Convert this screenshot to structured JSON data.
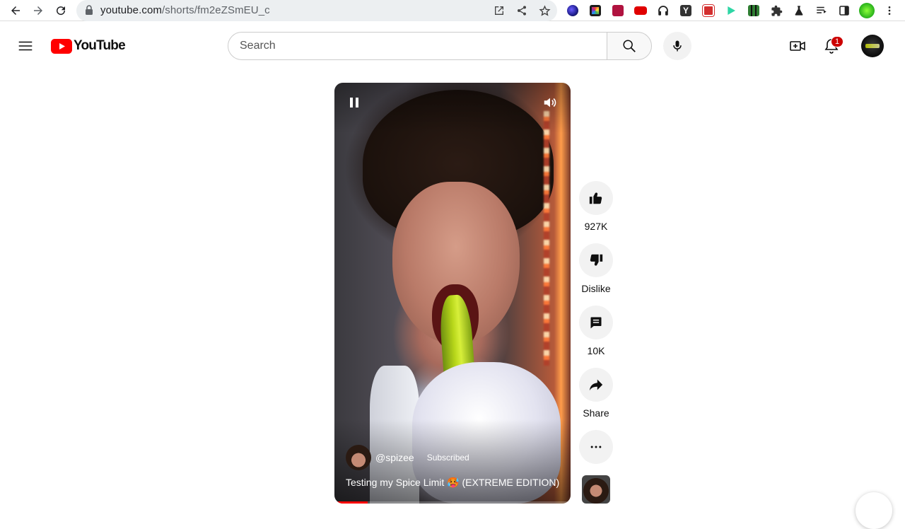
{
  "browser": {
    "url_host": "youtube.com",
    "url_path": "/shorts/fm2eZSmEU_c"
  },
  "header": {
    "logo_text": "YouTube",
    "search_placeholder": "Search",
    "notification_count": "1"
  },
  "short": {
    "channel_handle": "@spizee",
    "subscribe_state": "Subscribed",
    "title": "Testing my Spice Limit 🥵 (EXTREME EDITION)",
    "progress": 0.14
  },
  "actions": {
    "like_count": "927K",
    "dislike_label": "Dislike",
    "comment_count": "10K",
    "share_label": "Share"
  },
  "colors": {
    "brand_red": "#ff0000",
    "badge_red": "#cc0000"
  },
  "extensions": [
    {
      "icon": "globe-ext-icon",
      "color": "#3b3bd8"
    },
    {
      "icon": "camera-ext-icon",
      "color": "#1c1c1c"
    },
    {
      "icon": "music-ext-icon",
      "color": "#c2185b"
    },
    {
      "icon": "youtube-ext-icon",
      "color": "#e00000"
    },
    {
      "icon": "headphones-ext-icon",
      "color": "#222222"
    },
    {
      "icon": "y-ext-icon",
      "color": "#333333"
    },
    {
      "icon": "pdf-ext-icon",
      "color": "#d32f2f"
    },
    {
      "icon": "play-ext-icon",
      "color": "#2ed6a5"
    },
    {
      "icon": "grid-ext-icon",
      "color": "#2e7d32"
    },
    {
      "icon": "puzzle-icon",
      "color": "#333333"
    },
    {
      "icon": "flask-icon",
      "color": "#222222"
    },
    {
      "icon": "reading-list-icon",
      "color": "#222222"
    },
    {
      "icon": "side-panel-icon",
      "color": "#222222"
    },
    {
      "icon": "profile-icon",
      "color": "#3fcf2f"
    },
    {
      "icon": "more-vert-icon",
      "color": "#222222"
    }
  ]
}
